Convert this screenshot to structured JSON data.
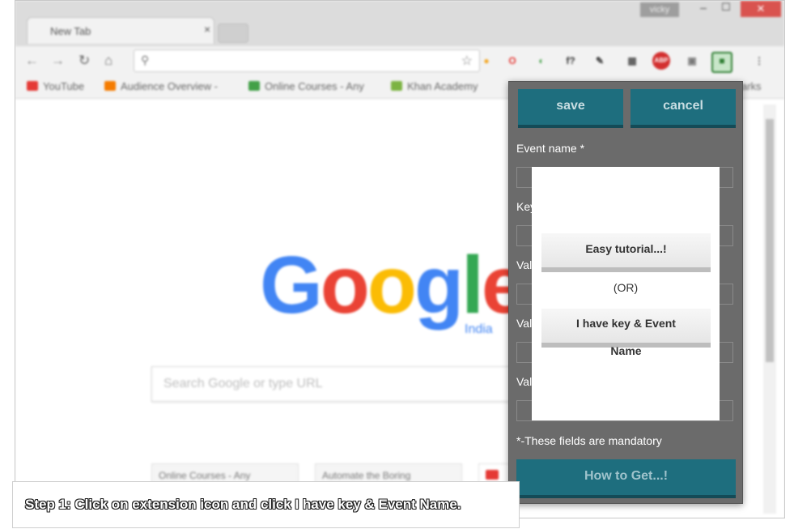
{
  "browser": {
    "tab_title": "New Tab",
    "tab_close": "×",
    "window": {
      "user_badge": "vicky",
      "minimize": "–",
      "maximize": "☐",
      "close": "✕"
    },
    "nav": {
      "back": "←",
      "forward": "→",
      "reload": "↻",
      "home": "⌂"
    },
    "omnibox": {
      "search_glyph": "⚲",
      "star_glyph": "☆",
      "value": ""
    },
    "extensions": [
      {
        "name": "orange-ext-icon",
        "glyph": "●",
        "color": "#f4a623"
      },
      {
        "name": "opera-icon",
        "glyph": "O",
        "color": "#e53935"
      },
      {
        "name": "green-circle-icon",
        "glyph": "◐",
        "color": "#43a047"
      },
      {
        "name": "function-icon",
        "glyph": "f?",
        "color": "#333333"
      },
      {
        "name": "evernote-icon",
        "glyph": "✎",
        "color": "#333333"
      },
      {
        "name": "chart-ext-icon",
        "glyph": "▦",
        "color": "#555555"
      },
      {
        "name": "adblock-icon",
        "glyph": "ABP",
        "color": "#d32f2f"
      },
      {
        "name": "gray-ext-icon",
        "glyph": "▣",
        "color": "#777777"
      },
      {
        "name": "active-extension-icon",
        "glyph": "■",
        "color": "#2e7d32"
      },
      {
        "name": "menu-icon",
        "glyph": "⋮",
        "color": "#666666"
      }
    ],
    "bookmarks": [
      {
        "label": "YouTube",
        "color": "#e53935"
      },
      {
        "label": "Audience Overview -",
        "color": "#f57c00"
      },
      {
        "label": "Online Courses - Any",
        "color": "#43a047"
      },
      {
        "label": "Khan Academy",
        "color": "#7cb342"
      }
    ],
    "bookmarks_overflow": "arks"
  },
  "newtab": {
    "logo": [
      {
        "letter": "G",
        "color": "#4285f4"
      },
      {
        "letter": "o",
        "color": "#ea4335"
      },
      {
        "letter": "o",
        "color": "#fbbc05"
      },
      {
        "letter": "g",
        "color": "#4285f4"
      },
      {
        "letter": "l",
        "color": "#34a853"
      },
      {
        "letter": "e",
        "color": "#ea4335"
      }
    ],
    "country": "India",
    "search_placeholder": "Search Google or type URL",
    "tiles": [
      {
        "label": "Online Courses - Any"
      },
      {
        "label": "Automate the Boring"
      }
    ]
  },
  "popup": {
    "save_label": "save",
    "cancel_label": "cancel",
    "event_name_label": "Event name *",
    "key_label": "Key",
    "value1_label": "Val",
    "value2_label": "Val",
    "value3_label": "Val",
    "mandatory_note": "*-These fields are mandatory",
    "how_to_label": "How to Get...!"
  },
  "dialog": {
    "easy_tutorial_label": "Easy tutorial...!",
    "or_label": "(OR)",
    "have_key_line1": "I have key & Event",
    "have_key_line2": "Name"
  },
  "caption": {
    "text": "Step 1: Click on extension icon and click I have key & Event Name."
  },
  "colors": {
    "teal": "#1e6e7e",
    "popup_bg": "#6b6b6b",
    "close_red": "#d9534f"
  }
}
